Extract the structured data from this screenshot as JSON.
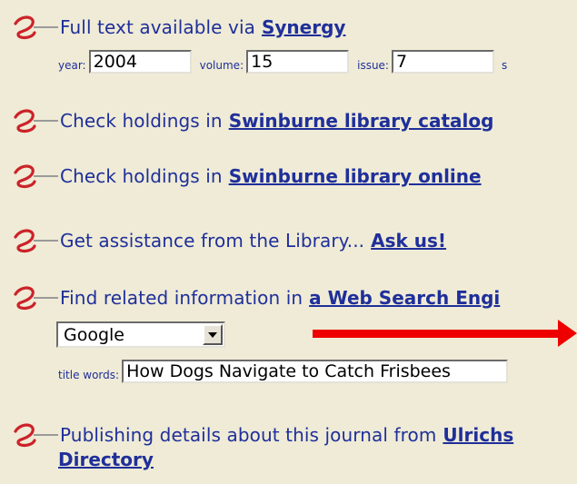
{
  "items": [
    {
      "text": "Full text available via",
      "link": "Synergy"
    },
    {
      "text": "Check holdings in",
      "link": "Swinburne library catalog"
    },
    {
      "text": "Check holdings in",
      "link": "Swinburne library online"
    },
    {
      "text": "Get assistance from the Library...",
      "link": "Ask us!"
    },
    {
      "text": "Find related information in",
      "link": "a Web Search Engi"
    },
    {
      "text": "Publishing details about this journal from",
      "link": "Ulrichs",
      "link_cont": "Directory"
    }
  ],
  "citation": {
    "year_label": "year:",
    "year_value": "2004",
    "volume_label": "volume:",
    "volume_value": "15",
    "issue_label": "issue:",
    "issue_value": "7",
    "next_label": "s"
  },
  "search": {
    "engine_selected": "Google",
    "title_label": "title words:",
    "title_value": "How Dogs Navigate to Catch Frisbees"
  },
  "colors": {
    "background": "#efebd6",
    "text": "#1f2f9a",
    "bullet": "#cc2229",
    "arrow": "#ee0000"
  },
  "icons": {
    "bullet": "sfx-swirl-icon",
    "dropdown": "dropdown-arrow-icon",
    "annotation": "red-arrow-icon"
  }
}
